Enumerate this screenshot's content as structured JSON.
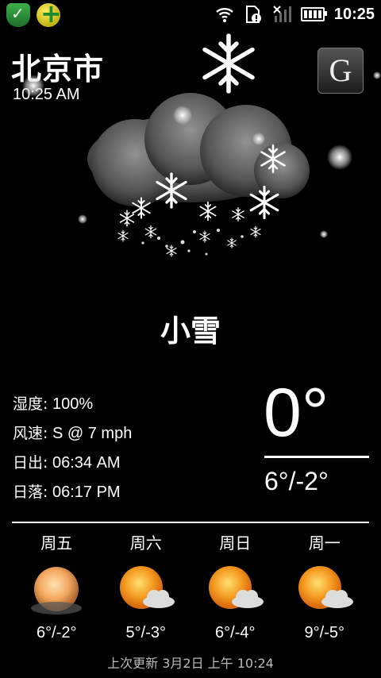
{
  "statusbar": {
    "time": "10:25",
    "icons": [
      "shield-app-icon",
      "plus-app-icon",
      "wifi-icon",
      "sim-alert-icon",
      "signal-icon",
      "battery-icon"
    ]
  },
  "location": {
    "city": "北京市",
    "time": "10:25 AM"
  },
  "toolbar": {
    "g_label": "G"
  },
  "current": {
    "condition": "小雪",
    "condition_icon": "snow-cloud-icon",
    "temp": "0°",
    "hilo": "6°/-2°",
    "details": [
      {
        "label": "湿度:",
        "value": "100%"
      },
      {
        "label": "风速:",
        "value": "S @ 7 mph"
      },
      {
        "label": "日出:",
        "value": "06:34 AM"
      },
      {
        "label": "日落:",
        "value": "06:17 PM"
      }
    ]
  },
  "forecast": [
    {
      "day": "周五",
      "range": "6°/-2°",
      "icon": "hazy-sun-icon"
    },
    {
      "day": "周六",
      "range": "5°/-3°",
      "icon": "sun-cloud-icon"
    },
    {
      "day": "周日",
      "range": "6°/-4°",
      "icon": "sun-cloud-icon"
    },
    {
      "day": "周一",
      "range": "9°/-5°",
      "icon": "sun-cloud-icon"
    }
  ],
  "footer": {
    "updated": "上次更新 3月2日 上午 10:24"
  },
  "colors": {
    "background": "#000000",
    "text": "#ffffff",
    "sun": "#f5a623"
  }
}
